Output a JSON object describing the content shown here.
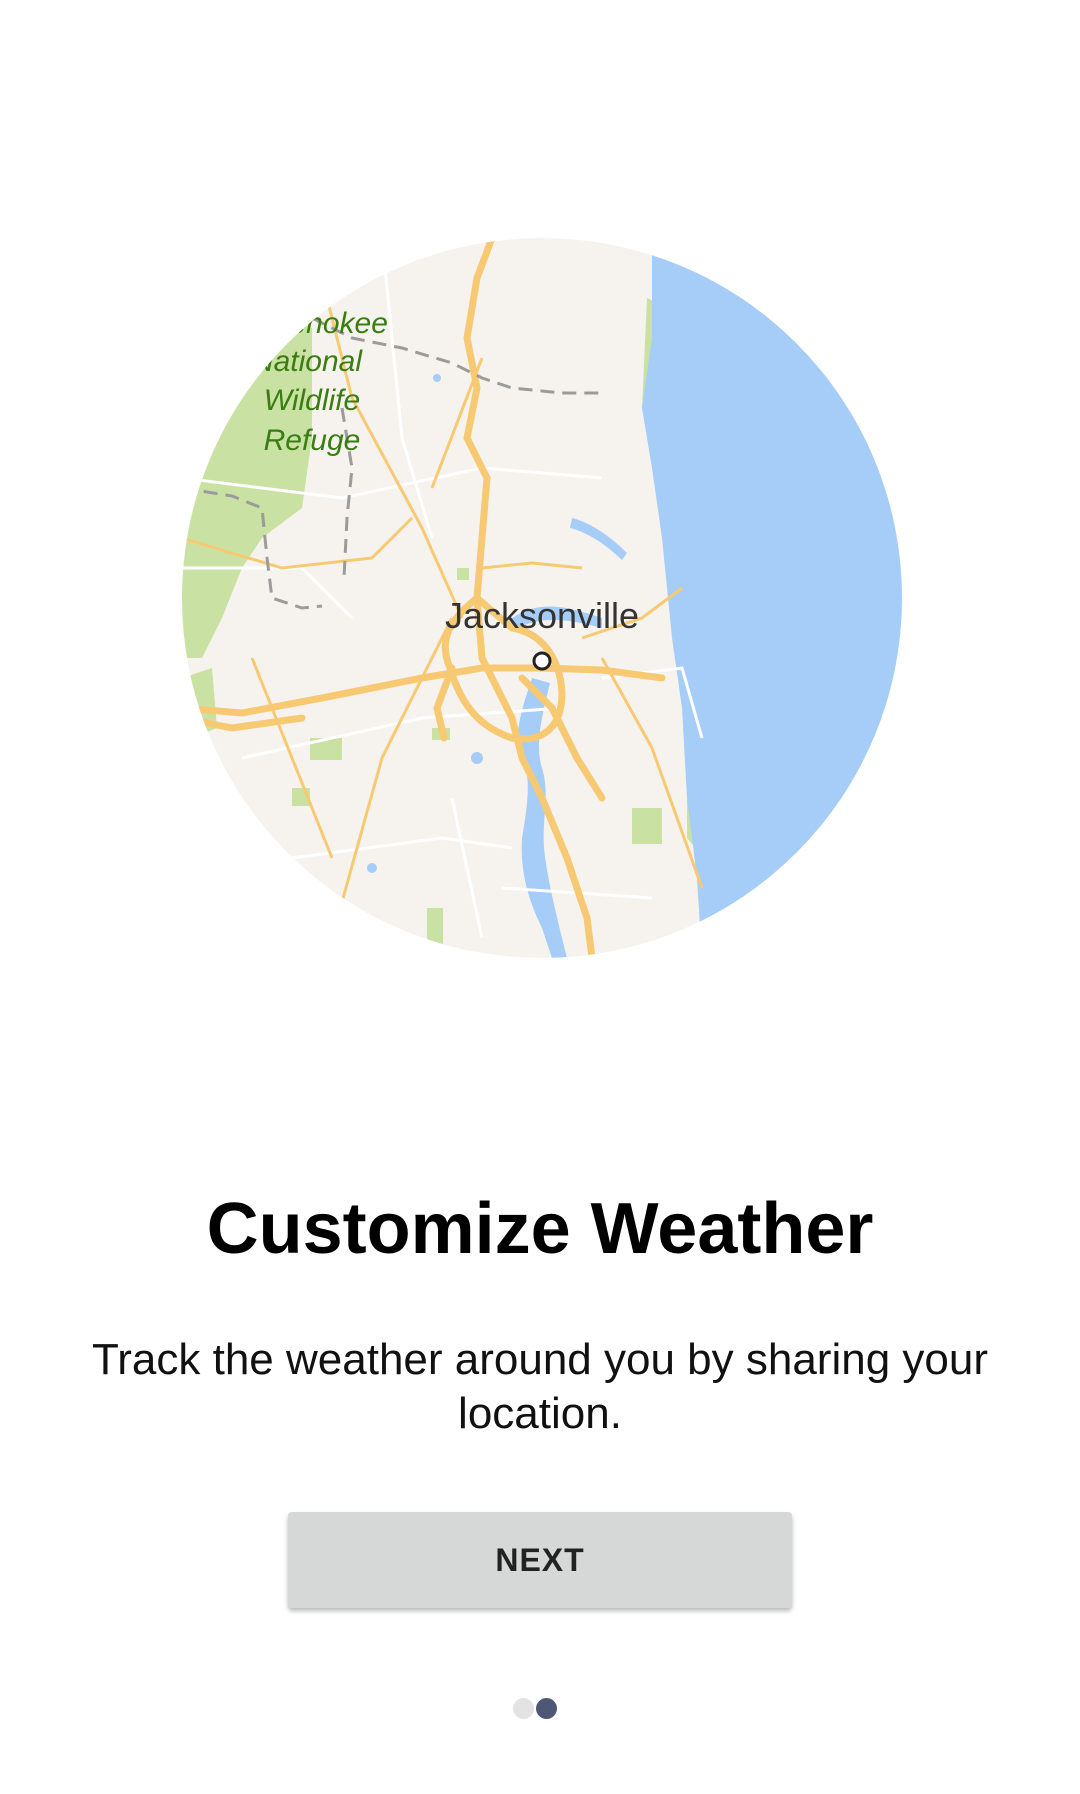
{
  "map": {
    "city_label": "Jacksonville",
    "refuge_label_lines": [
      "Okefenokee",
      "National",
      "Wildlife",
      "Refuge"
    ],
    "colors": {
      "land": "#f6f3ee",
      "water": "#a6cdf7",
      "park": "#c9e2a4",
      "highway": "#f7c972",
      "park_text": "#3a7d10"
    }
  },
  "onboarding": {
    "title": "Customize Weather",
    "description": "Track the weather around you by sharing your location.",
    "next_label": "NEXT"
  },
  "pager": {
    "total_pages": 2,
    "current_page": 2,
    "active_color": "#4e5776",
    "inactive_color": "#e3e3e3"
  }
}
